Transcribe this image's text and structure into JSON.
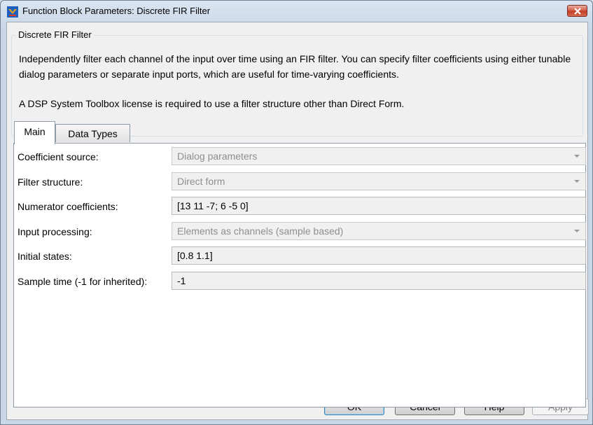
{
  "window": {
    "title": "Function Block Parameters: Discrete FIR Filter",
    "icon": "simulink-block-icon",
    "close_icon": "close-icon"
  },
  "group": {
    "title": "Discrete FIR Filter",
    "description_1": "Independently filter each channel of the input over time using an FIR filter. You can specify filter coefficients using either tunable dialog parameters or separate input ports, which are useful for time-varying coefficients.",
    "description_2": "A DSP System Toolbox license is required to use a filter structure other than Direct Form."
  },
  "tabs": [
    {
      "label": "Main",
      "active": true
    },
    {
      "label": "Data Types",
      "active": false
    }
  ],
  "params": {
    "coefficient_source": {
      "label": "Coefficient source:",
      "value": "Dialog parameters"
    },
    "filter_structure": {
      "label": "Filter structure:",
      "value": "Direct form"
    },
    "numerator_coefficients": {
      "label": "Numerator coefficients:",
      "value": "[13 11 -7; 6 -5 0]"
    },
    "input_processing": {
      "label": "Input processing:",
      "value": "Elements as channels (sample based)"
    },
    "initial_states": {
      "label": "Initial states:",
      "value": "[0.8 1.1]"
    },
    "sample_time": {
      "label": "Sample time (-1 for inherited):",
      "value": "-1"
    }
  },
  "buttons": {
    "ok": "OK",
    "cancel": "Cancel",
    "help": "Help",
    "apply": "Apply"
  },
  "colors": {
    "frame": "#c9d7e7",
    "close": "#c13a24",
    "disabled_text": "#8e8e8e"
  }
}
